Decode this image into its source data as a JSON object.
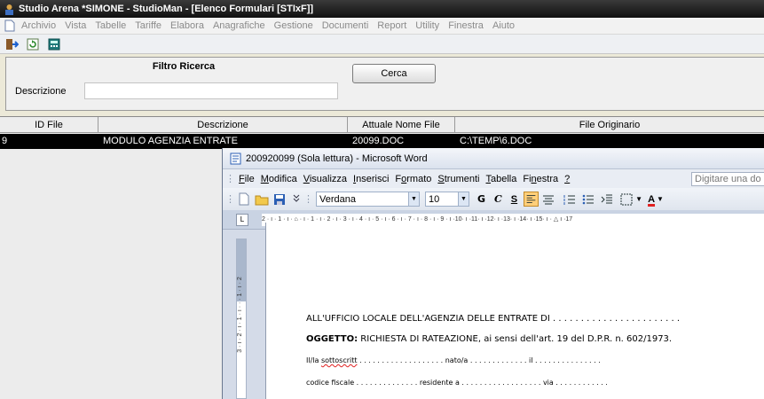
{
  "window": {
    "title": "Studio Arena *SIMONE - StudioMan - [Elenco Formulari  [STIxF]]"
  },
  "menu": [
    "Archivio",
    "Vista",
    "Tabelle",
    "Tariffe",
    "Elabora",
    "Anagrafiche",
    "Gestione",
    "Documenti",
    "Report",
    "Utility",
    "Finestra",
    "Aiuto"
  ],
  "filter": {
    "title": "Filtro Ricerca",
    "desc_label": "Descrizione",
    "desc_value": "",
    "search_button": "Cerca"
  },
  "grid": {
    "columns": [
      "ID File",
      "Descrizione",
      "Attuale Nome File",
      "File Originario"
    ],
    "rows": [
      {
        "id": "9",
        "descrizione": "MODULO AGENZIA ENTRATE",
        "attuale": "20099.DOC",
        "originario": "C:\\TEMP\\6.DOC"
      }
    ]
  },
  "word": {
    "title": "200920099 (Sola lettura) - Microsoft Word",
    "menu": [
      {
        "u": "F",
        "rest": "ile"
      },
      {
        "u": "M",
        "rest": "odifica"
      },
      {
        "u": "V",
        "rest": "isualizza"
      },
      {
        "u": "I",
        "rest": "nserisci"
      },
      {
        "pre": "F",
        "u": "o",
        "rest": "rmato"
      },
      {
        "u": "S",
        "rest": "trumenti"
      },
      {
        "u": "T",
        "rest": "abella"
      },
      {
        "pre": "Fi",
        "u": "n",
        "rest": "estra"
      },
      {
        "u": "?",
        "rest": ""
      }
    ],
    "help_placeholder": "Digitare una do",
    "font": "Verdana",
    "size": "10",
    "ruler_text": "2 · ı · 1 · ı · ⌂ · ı · 1 · ı · 2 · ı · 3 · ı · 4 · ı · 5 · ı · 6 · ı · 7 · ı · 8 · ı · 9 · ı ·10· ı ·11· ı ·12· ı ·13· ı ·14· ı ·15· ı · △ ı ·17",
    "vruler_text": "3 · ı · 2 · ı · 1 · ı · · · 1 · ı · 2",
    "doc": {
      "line1": "ALL'UFFICIO LOCALE DELL'AGENZIA DELLE ENTRATE DI . . . . . . . . . . . . . . . . . . . . . . .",
      "line2_bold": "OGGETTO:",
      "line2_rest": " RICHIESTA DI RATEAZIONE, ai sensi dell'art. 19 del D.P.R. n. 602/1973.",
      "line3_a": "Il/la ",
      "line3_b": "sottoscritt",
      "line3_c": " . . . . . . . . . . . . . . . . . . . nato/a . . . . . . . . . . . . . il . . . . . . . . . . . . . . .",
      "line4": "codice fiscale . . . . . . . . . . . . . . residente a . . . . . . . . . . . . . . . . . . via . . . . . . . . . . . ."
    }
  },
  "colors": {
    "accent_blue": "#2b5fb4",
    "selected_row": "#000000"
  }
}
